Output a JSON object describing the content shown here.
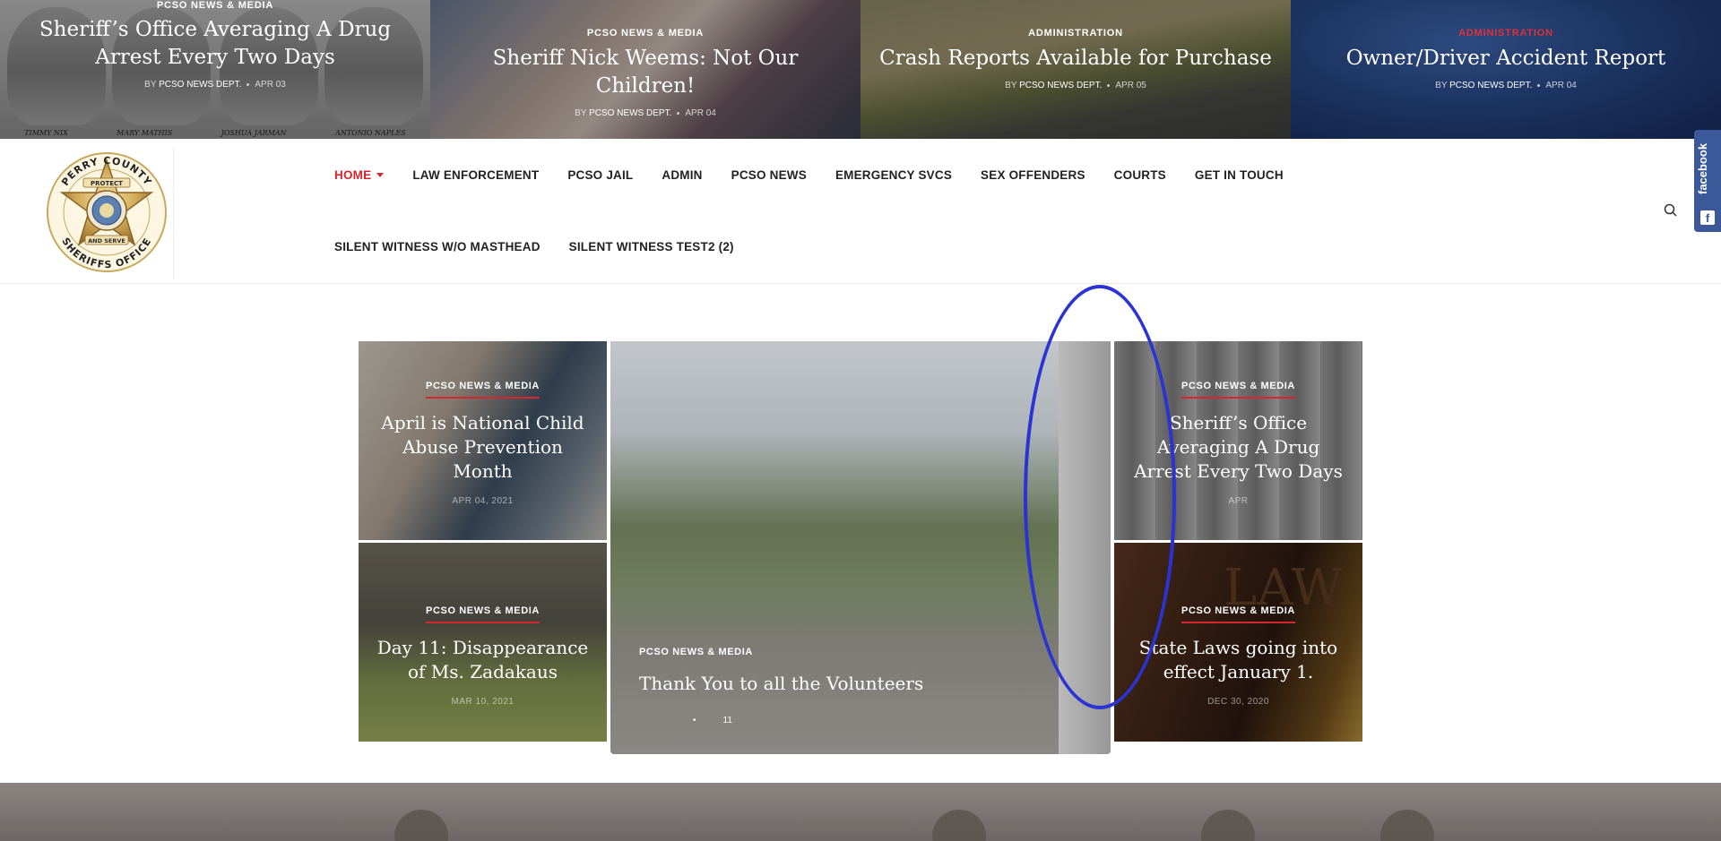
{
  "ticker": [
    {
      "category": "PCSO NEWS & MEDIA",
      "title_lines": [
        "Sheriff’s Office Averaging A Drug",
        "Arrest Every Two Days"
      ],
      "by": "BY",
      "author": "PCSO NEWS DEPT.",
      "date": "APR 03",
      "mugshot_names": [
        "TIMMY NIX",
        "MARY MATHIS",
        "JOSHUA JARMAN",
        "ANTONIO NAPLES"
      ]
    },
    {
      "category": "PCSO NEWS & MEDIA",
      "title_lines": [
        "Sheriff Nick Weems: Not Our Children!"
      ],
      "by": "BY",
      "author": "PCSO NEWS DEPT.",
      "date": "APR 04"
    },
    {
      "category": "ADMINISTRATION",
      "title_lines": [
        "Crash Reports Available for Purchase"
      ],
      "by": "BY",
      "author": "PCSO NEWS DEPT.",
      "date": "APR 05"
    },
    {
      "category": "ADMINISTRATION",
      "title_lines": [
        "Owner/Driver Accident Report"
      ],
      "by": "BY",
      "author": "PCSO NEWS DEPT.",
      "date": "APR 04",
      "category_color": "#e0303a"
    }
  ],
  "logo": {
    "top_text": "PERRY COUNTY",
    "bottom_text": "SHERIFFS OFFICE",
    "ribbon_top": "PROTECT",
    "ribbon_bottom": "AND SERVE"
  },
  "nav": {
    "row1": [
      "HOME",
      "LAW ENFORCEMENT",
      "PCSO JAIL",
      "ADMIN",
      "PCSO NEWS",
      "EMERGENCY SVCS",
      "SEX OFFENDERS",
      "COURTS",
      "GET IN TOUCH"
    ],
    "row2": [
      "SILENT WITNESS W/O MASTHEAD",
      "SILENT WITNESS TEST2 (2)"
    ],
    "active": "HOME",
    "accent_color": "#d6262f"
  },
  "facebook_tab": {
    "label": "facebook",
    "icon": "f"
  },
  "grid": {
    "card1": {
      "category": "PCSO NEWS & MEDIA",
      "title": "April is National Child Abuse Prevention Month",
      "date": "APR 04, 2021"
    },
    "card2": {
      "category": "PCSO NEWS & MEDIA",
      "title": "Day 11: Disappearance of Ms. Zadakaus",
      "date": "MAR 10, 2021"
    },
    "feature": {
      "category": "PCSO NEWS & MEDIA",
      "title": "Thank You to all the Volunteers",
      "dots": "11"
    },
    "card3": {
      "category": "PCSO NEWS & MEDIA",
      "title": "Sheriff’s Office Averaging A Drug Arrest Every Two Days",
      "date": "APR"
    },
    "card4": {
      "category": "PCSO NEWS & MEDIA",
      "title": "State Laws going into effect January 1.",
      "date": "DEC 30, 2020",
      "book_text": "LAW"
    }
  }
}
